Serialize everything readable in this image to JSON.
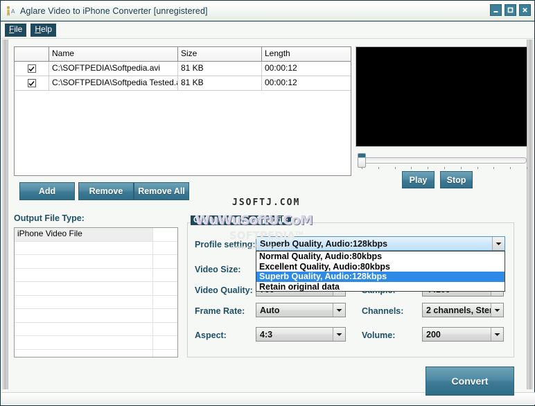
{
  "window": {
    "title": "Aglare Video to iPhone Converter  [unregistered]",
    "icon": "app-person-icon",
    "controls": {
      "minimize": "minimize-icon",
      "maximize": "maximize-icon",
      "close": "close-icon"
    },
    "accent": "#2f6d88",
    "title_color": "#17394a"
  },
  "menu": [
    {
      "name": "file",
      "accel": "F",
      "rest": "ile"
    },
    {
      "name": "help",
      "accel": "H",
      "rest": "elp"
    }
  ],
  "file_list": {
    "columns": [
      "",
      "Name",
      "Size",
      "Length"
    ],
    "rows": [
      {
        "checked": true,
        "name": "C:\\SOFTPEDIA\\Softpedia.avi",
        "size": "81 KB",
        "length": "00:00:12"
      },
      {
        "checked": true,
        "name": "C:\\SOFTPEDIA\\Softpedia Tested.avi",
        "size": "81 KB",
        "length": "00:00:12"
      }
    ]
  },
  "list_buttons": {
    "add": "Add",
    "remove": "Remove",
    "remove_all": "Remove All"
  },
  "player": {
    "play": "Play",
    "stop": "Stop",
    "seek_position": 0,
    "tick_count": 11
  },
  "output_file_type": {
    "label": "Output File Type:",
    "items": [
      "iPhone Video File"
    ],
    "selected_index": 0,
    "empty_rows": 9
  },
  "options": {
    "group_title": "Options of the output file",
    "fields": [
      {
        "label": "Profile setting:",
        "value": "Superb Quality, Audio:128kbps"
      },
      {
        "label": "Video Size:",
        "value": ""
      },
      {
        "label": "Video Quality:",
        "value": "700"
      },
      {
        "label": "Frame Rate:",
        "value": "Auto"
      },
      {
        "label": "Aspect:",
        "value": "4:3"
      }
    ],
    "right_fields": [
      {
        "label": "Sample:",
        "value": "44100"
      },
      {
        "label": "Channels:",
        "value": "2 channels, Ster"
      },
      {
        "label": "Volume:",
        "value": "200"
      }
    ],
    "profile_dropdown": {
      "open": true,
      "options": [
        "Normal Quality, Audio:80kbps",
        "Excellent Quality, Audio:80kbps",
        "Superb Quality, Audio:128kbps",
        "Retain original data"
      ],
      "highlighted_index": 2,
      "highlight_color": "#2e8ae5"
    }
  },
  "convert_button": "Convert",
  "watermarks": {
    "jsoftj": "JSOFTJ.COM",
    "wuwu": "WuWuSoftU.CoM",
    "softpedia": "SOFTPEDIA",
    "softpedia_tm": "TM",
    "softpedia_url": "www.softpedia.com"
  }
}
